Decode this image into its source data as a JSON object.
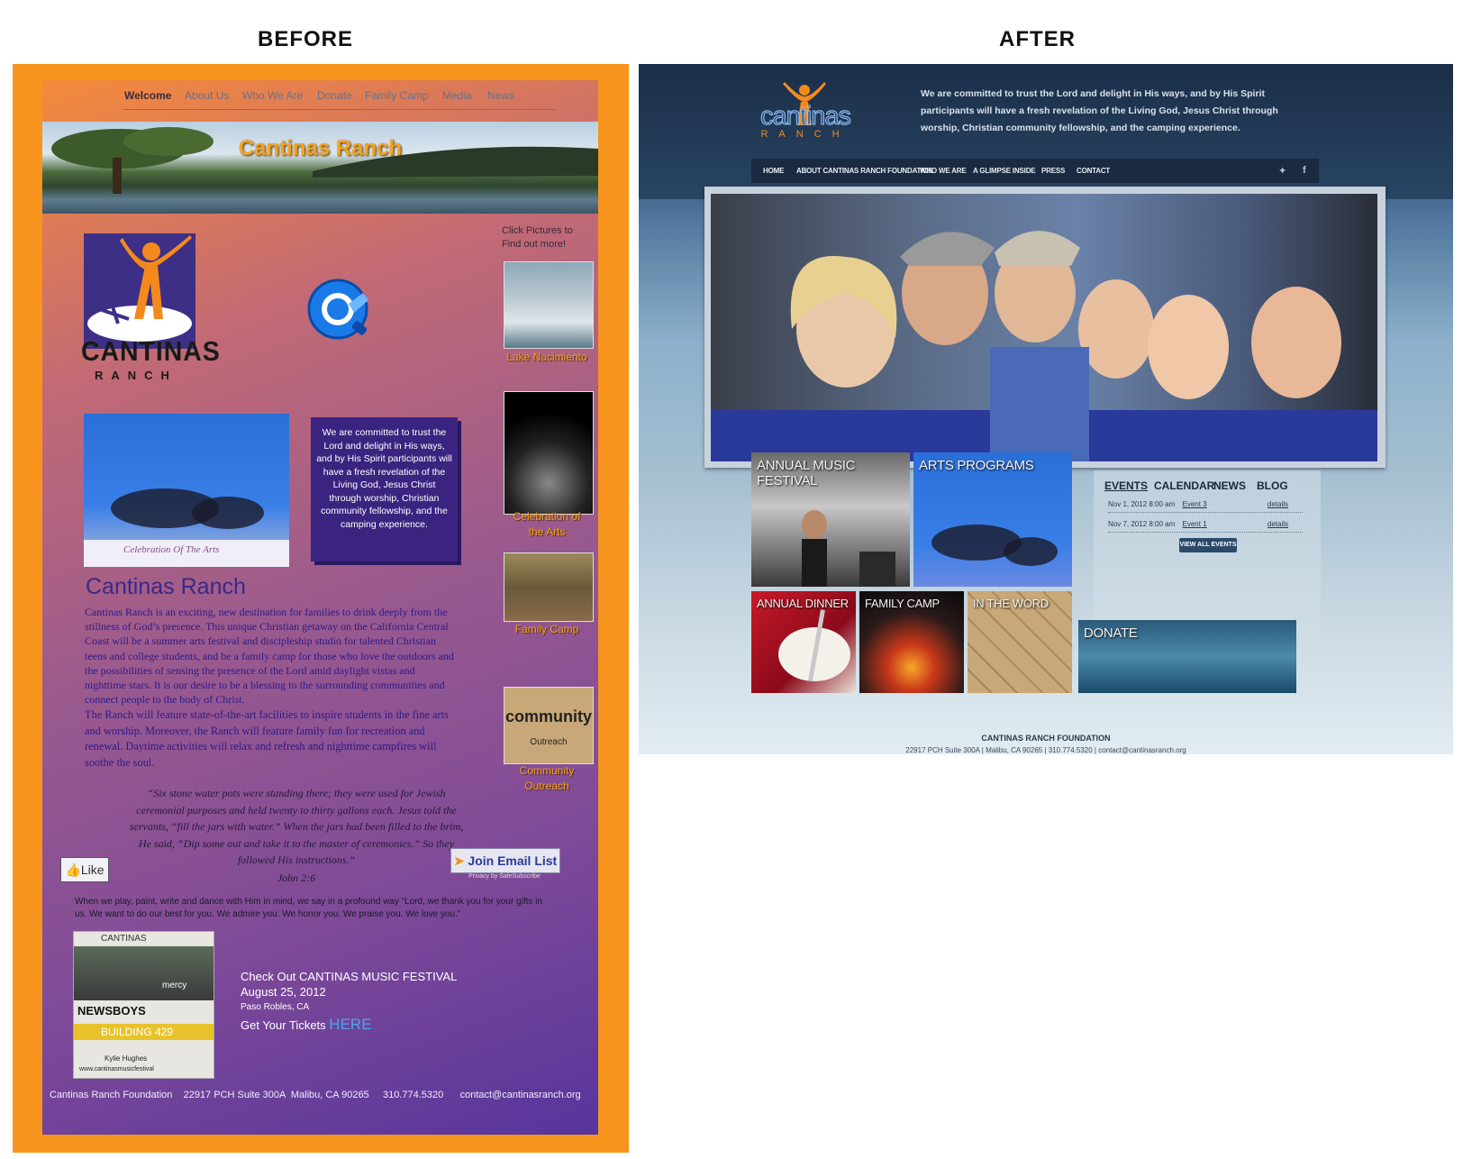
{
  "labels": {
    "before": "BEFORE",
    "after": "AFTER"
  },
  "before": {
    "nav": [
      "Welcome",
      "About Us",
      "Who We Are",
      "Donate",
      "Family Camp",
      "Media",
      "News"
    ],
    "banner_title": "Cantinas Ranch",
    "logo_text": "CANTINAS",
    "logo_subtext": "RANCH",
    "click_text": "Click Pictures to Find out more!",
    "thumbs": [
      "Lake Nacimiento",
      "Celebration of the Arts",
      "Family Camp",
      "Community Outreach"
    ],
    "thumb_art_words": [
      "community",
      "Outreach"
    ],
    "dance_caption": "Celebration Of The Arts",
    "commitment": "We are committed to trust the Lord and delight in His ways, and by His Spirit participants will have a fresh revelation of the Living God, Jesus Christ through worship, Christian community fellowship, and the camping experience.",
    "title": "Cantinas Ranch",
    "body_p1": "Cantinas Ranch is an exciting, new destination for families to drink deeply from the stillness of God’s presence. This unique Christian getaway on the California Central Coast will be a summer arts festival and discipleship studio for talented Christian teens and college students, and be a family camp for those who love the outdoors and the possibilities of sensing the presence of the Lord amid daylight vistas and nighttime stars. It is our desire to be a blessing to the surrounding communities and connect people to the body of Christ.",
    "body_p2": "The Ranch will feature state-of-the-art facilities to inspire students in the fine arts and worship. Moreover, the Ranch will feature family fun for recreation and renewal. Daytime activities will relax and refresh and nighttime campfires will soothe the soul.",
    "quote": "“Six stone water pots were standing there; they were used for Jewish ceremonial purposes and held twenty to thirty gallons each. Jesus told the servants, “fill the jars with water.” When the jars had been filled to the brim, He said, “Dip some out and take it to the master of ceremonies.” So they followed His instructions.”",
    "quote_ref": "John 2:6",
    "like": "Like",
    "email_button": "Join Email List",
    "safe_subscribe": "Privacy by SafeSubscribe",
    "prayer": "When we play, paint, write and dance with Him in mind, we say in a profound way “Lord, we thank you for your gifts in us. We want to do our best for you. We admire you. We honor you. We praise you. We love you.”",
    "poster_lines": [
      "CANTINAS",
      "mercy",
      "NEWSBOYS",
      "BUILDING 429",
      "Kylie Hughes",
      "www.cantinasmusicfestival"
    ],
    "festival_line1": "Check Out CANTINAS MUSIC FESTIVAL",
    "festival_line2": "August 25, 2012",
    "festival_line3": "Paso Robles, CA",
    "festival_line4": "Get Your Tickets",
    "festival_link": "HERE",
    "footer": "Cantinas Ranch Foundation    22917 PCH Suite 300A  Malibu, CA 90265     310.774.5320      contact@cantinasranch.org"
  },
  "after": {
    "logo_word": "cantinas",
    "logo_sub": "RANCH",
    "tagline": "We are committed to trust the Lord and delight in His ways, and by His Spirit participants will have a fresh revelation of the Living God, Jesus Christ through worship, Christian community fellowship, and the camping experience.",
    "nav": [
      "HOME",
      "ABOUT CANTINAS RANCH FOUNDATION",
      "WHO WE ARE",
      "A GLIMPSE INSIDE",
      "PRESS",
      "CONTACT"
    ],
    "social": [
      "twitter-icon",
      "facebook-icon"
    ],
    "tiles": {
      "music": "ANNUAL MUSIC FESTIVAL",
      "arts": "ARTS PROGRAMS",
      "dinner": "ANNUAL DINNER",
      "camp": "FAMILY CAMP",
      "word": "IN THE WORD",
      "donate": "DONATE"
    },
    "event_tabs": [
      "EVENTS",
      "CALENDAR",
      "NEWS",
      "BLOG"
    ],
    "events": [
      {
        "date": "Nov 1, 2012 8:00 am",
        "name": "Event 3",
        "link": "details"
      },
      {
        "date": "Nov 7, 2012 8:00 am",
        "name": "Event 1",
        "link": "details"
      }
    ],
    "view_all": "VIEW ALL EVENTS",
    "footer_title": "CANTINAS RANCH FOUNDATION",
    "footer_addr": "22917 PCH Suite 300A | Malibu, CA 90265 | 310.774.5320 | contact@cantinasranch.org"
  }
}
